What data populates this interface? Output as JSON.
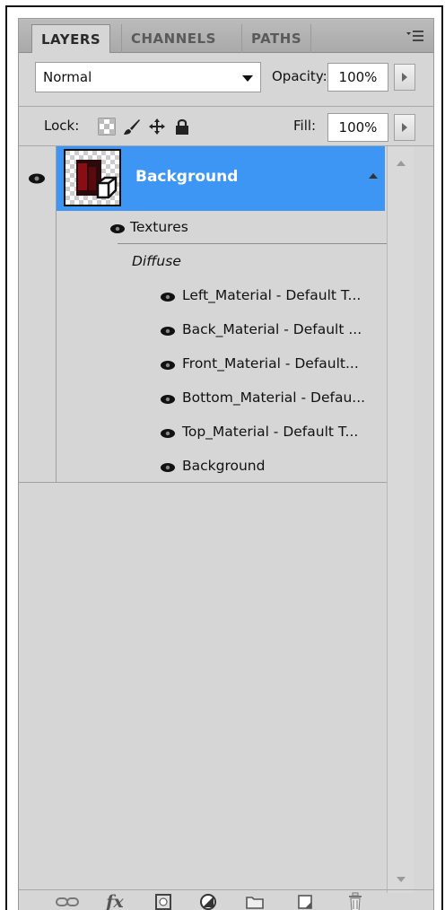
{
  "tabs": [
    {
      "label": "LAYERS",
      "active": true
    },
    {
      "label": "CHANNELS",
      "active": false
    },
    {
      "label": "PATHS",
      "active": false
    }
  ],
  "blend": {
    "mode": "Normal",
    "opacity_label": "Opacity:",
    "opacity_value": "100%"
  },
  "lock": {
    "label": "Lock:",
    "fill_label": "Fill:",
    "fill_value": "100%"
  },
  "layer": {
    "name": "Background"
  },
  "effects": {
    "group_label": "Textures",
    "section_label": "Diffuse",
    "items": [
      "Left_Material - Default T...",
      "Back_Material - Default ...",
      "Front_Material - Default...",
      "Bottom_Material - Defau...",
      "Top_Material - Default T...",
      "Background"
    ]
  },
  "bottom_icons": [
    "link-layers-icon",
    "fx-icon",
    "layer-mask-icon",
    "adjustment-layer-icon",
    "group-folder-icon",
    "new-layer-icon",
    "trash-icon"
  ],
  "bottom_fx_text": "fx",
  "colors": {
    "selection": "#3d96f4",
    "panel": "#d6d6d6"
  }
}
